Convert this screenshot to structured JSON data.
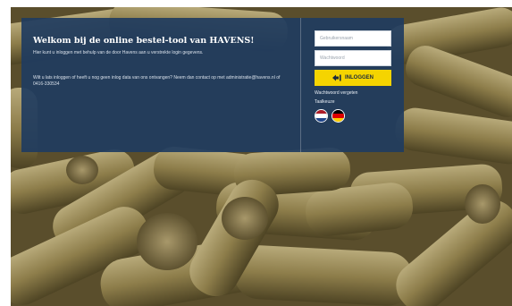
{
  "panel": {
    "title": "Welkom bij de online bestel-tool van HAVENS!",
    "intro": "Hier kunt u inloggen met behulp van de door Havens aan u verstrekte login gegevens.",
    "help": "Wilt u lats inloggen of heeft u nog geen inlog data van ons ontvangen? Neem dan contact op met administratie@havens.nl of 0416-330534"
  },
  "login": {
    "username_placeholder": "Gebruikersnaam",
    "password_placeholder": "Wachtwoord",
    "button_label": "INLOGGEN",
    "forgot_link": "Wachtwoord vergeten",
    "language_label": "Taalkeuze",
    "languages": [
      {
        "code": "nl",
        "colors": [
          "#ae1c28",
          "#ffffff",
          "#21468b"
        ]
      },
      {
        "code": "de",
        "colors": [
          "#000000",
          "#dd0000",
          "#ffce00"
        ]
      }
    ]
  },
  "colors": {
    "panel_bg": "#203c60",
    "button_bg": "#f5d400",
    "pellet": "#8a7a45"
  }
}
